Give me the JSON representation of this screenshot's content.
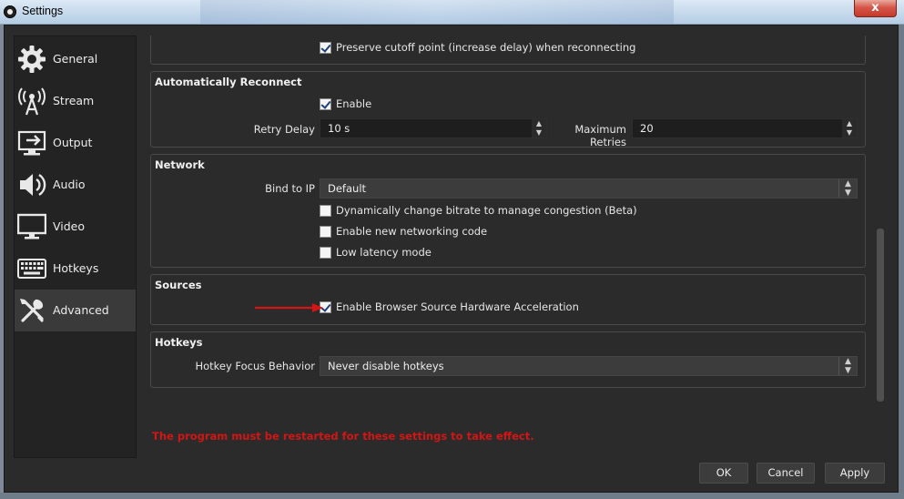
{
  "window": {
    "title": "Settings",
    "close_label": "x"
  },
  "sidebar": {
    "items": [
      {
        "label": "General",
        "icon": "gear-icon"
      },
      {
        "label": "Stream",
        "icon": "broadcast-icon"
      },
      {
        "label": "Output",
        "icon": "output-icon"
      },
      {
        "label": "Audio",
        "icon": "speaker-icon"
      },
      {
        "label": "Video",
        "icon": "monitor-icon"
      },
      {
        "label": "Hotkeys",
        "icon": "keyboard-icon"
      },
      {
        "label": "Advanced",
        "icon": "tools-icon",
        "active": true
      }
    ]
  },
  "top": {
    "preserve_cutoff_label": "Preserve cutoff point (increase delay) when reconnecting",
    "preserve_cutoff_checked": true
  },
  "auto_reconnect": {
    "title": "Automatically Reconnect",
    "enable_label": "Enable",
    "enable_checked": true,
    "retry_delay_label": "Retry Delay",
    "retry_delay_value": "10 s",
    "max_retries_label": "Maximum Retries",
    "max_retries_value": "20"
  },
  "network": {
    "title": "Network",
    "bind_to_ip_label": "Bind to IP",
    "bind_to_ip_value": "Default",
    "dynamic_bitrate_label": "Dynamically change bitrate to manage congestion (Beta)",
    "dynamic_bitrate_checked": false,
    "new_networking_label": "Enable new networking code",
    "new_networking_checked": false,
    "low_latency_label": "Low latency mode",
    "low_latency_checked": false
  },
  "sources": {
    "title": "Sources",
    "browser_accel_label": "Enable Browser Source Hardware Acceleration",
    "browser_accel_checked": true
  },
  "hotkeys": {
    "title": "Hotkeys",
    "focus_label": "Hotkey Focus Behavior",
    "focus_value": "Never disable hotkeys"
  },
  "restart_message": "The program must be restarted for these settings to take effect.",
  "buttons": {
    "ok": "OK",
    "cancel": "Cancel",
    "apply": "Apply"
  },
  "colors": {
    "annotation_arrow": "#d41515",
    "restart_text": "#d41515"
  }
}
